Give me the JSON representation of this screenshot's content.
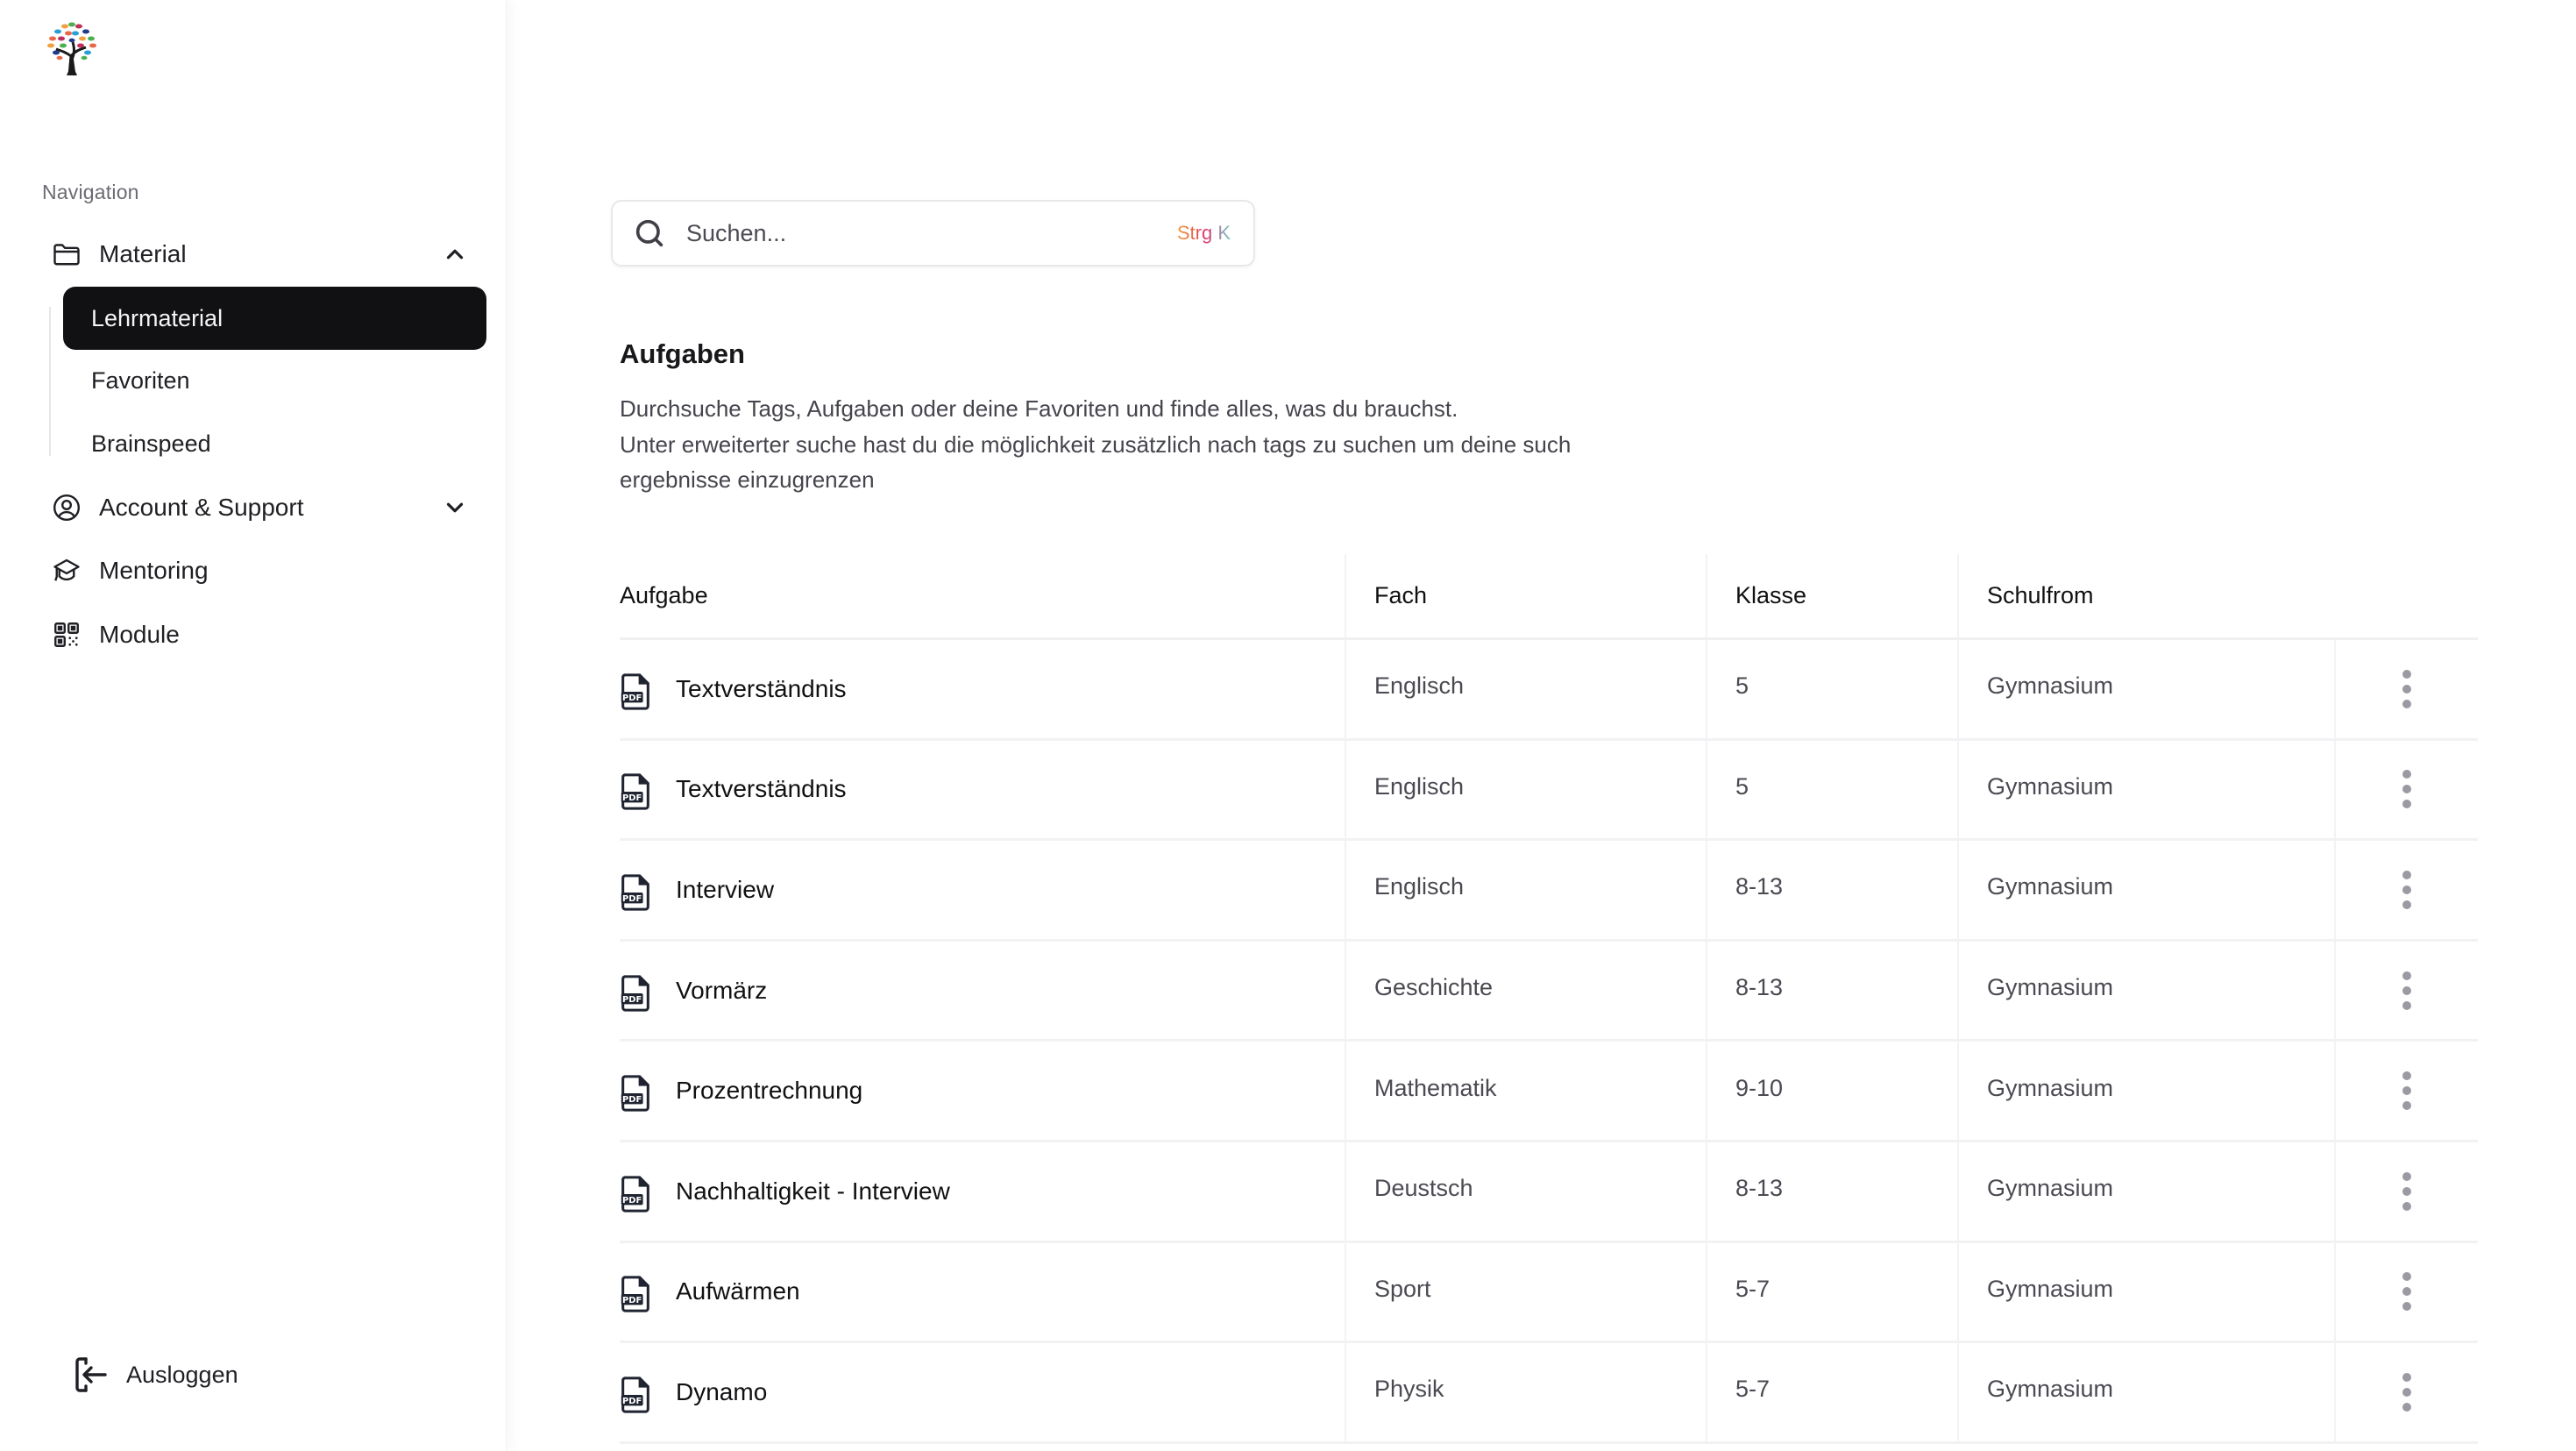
{
  "sidebar": {
    "logo": "tree-logo",
    "section_label": "Navigation",
    "items": [
      {
        "label": "Material",
        "icon": "folder-icon",
        "expanded": true,
        "children": [
          {
            "label": "Lehrmaterial",
            "active": true
          },
          {
            "label": "Favoriten",
            "active": false
          },
          {
            "label": "Brainspeed",
            "active": false
          }
        ]
      },
      {
        "label": "Account & Support",
        "icon": "user-circle-icon",
        "expanded": false
      },
      {
        "label": "Mentoring",
        "icon": "graduation-cap-icon"
      },
      {
        "label": "Module",
        "icon": "qr-grid-icon"
      }
    ],
    "logout_label": "Ausloggen"
  },
  "search": {
    "placeholder": "Suchen...",
    "value": "",
    "shortcut": "Strg K"
  },
  "main": {
    "title": "Aufgaben",
    "description": [
      "Durchsuche Tags, Aufgaben oder deine Favoriten und finde alles, was du brauchst.",
      "Unter erweiterter suche hast du die möglichkeit zusätzlich nach tags zu suchen um deine such",
      "ergebnisse einzugrenzen"
    ]
  },
  "table": {
    "columns": [
      "Aufgabe",
      "Fach",
      "Klasse",
      "Schulfrom"
    ],
    "rows": [
      {
        "aufgabe": "Textverständnis",
        "fach": "Englisch",
        "klasse": "5",
        "schulform": "Gymnasium"
      },
      {
        "aufgabe": "Textverständnis",
        "fach": "Englisch",
        "klasse": "5",
        "schulform": "Gymnasium"
      },
      {
        "aufgabe": "Interview",
        "fach": "Englisch",
        "klasse": "8-13",
        "schulform": "Gymnasium"
      },
      {
        "aufgabe": "Vormärz",
        "fach": "Geschichte",
        "klasse": "8-13",
        "schulform": "Gymnasium"
      },
      {
        "aufgabe": "Prozentrechnung",
        "fach": "Mathematik",
        "klasse": "9-10",
        "schulform": "Gymnasium"
      },
      {
        "aufgabe": "Nachhaltigkeit - Interview",
        "fach": "Deustsch",
        "klasse": "8-13",
        "schulform": "Gymnasium"
      },
      {
        "aufgabe": "Aufwärmen",
        "fach": "Sport",
        "klasse": "5-7",
        "schulform": "Gymnasium"
      },
      {
        "aufgabe": "Dynamo",
        "fach": "Physik",
        "klasse": "5-7",
        "schulform": "Gymnasium"
      }
    ],
    "file_type_icon": "pdf-file-icon",
    "row_action_icon": "more-vertical-icon"
  },
  "colors": {
    "active_nav_bg": "#111113",
    "active_nav_text": "#f4f4f5",
    "text_primary": "#18181b",
    "text_secondary": "#4a4a52",
    "shortcut_gradient": [
      "#f0a040",
      "#e0306a",
      "#78c8b8"
    ]
  }
}
